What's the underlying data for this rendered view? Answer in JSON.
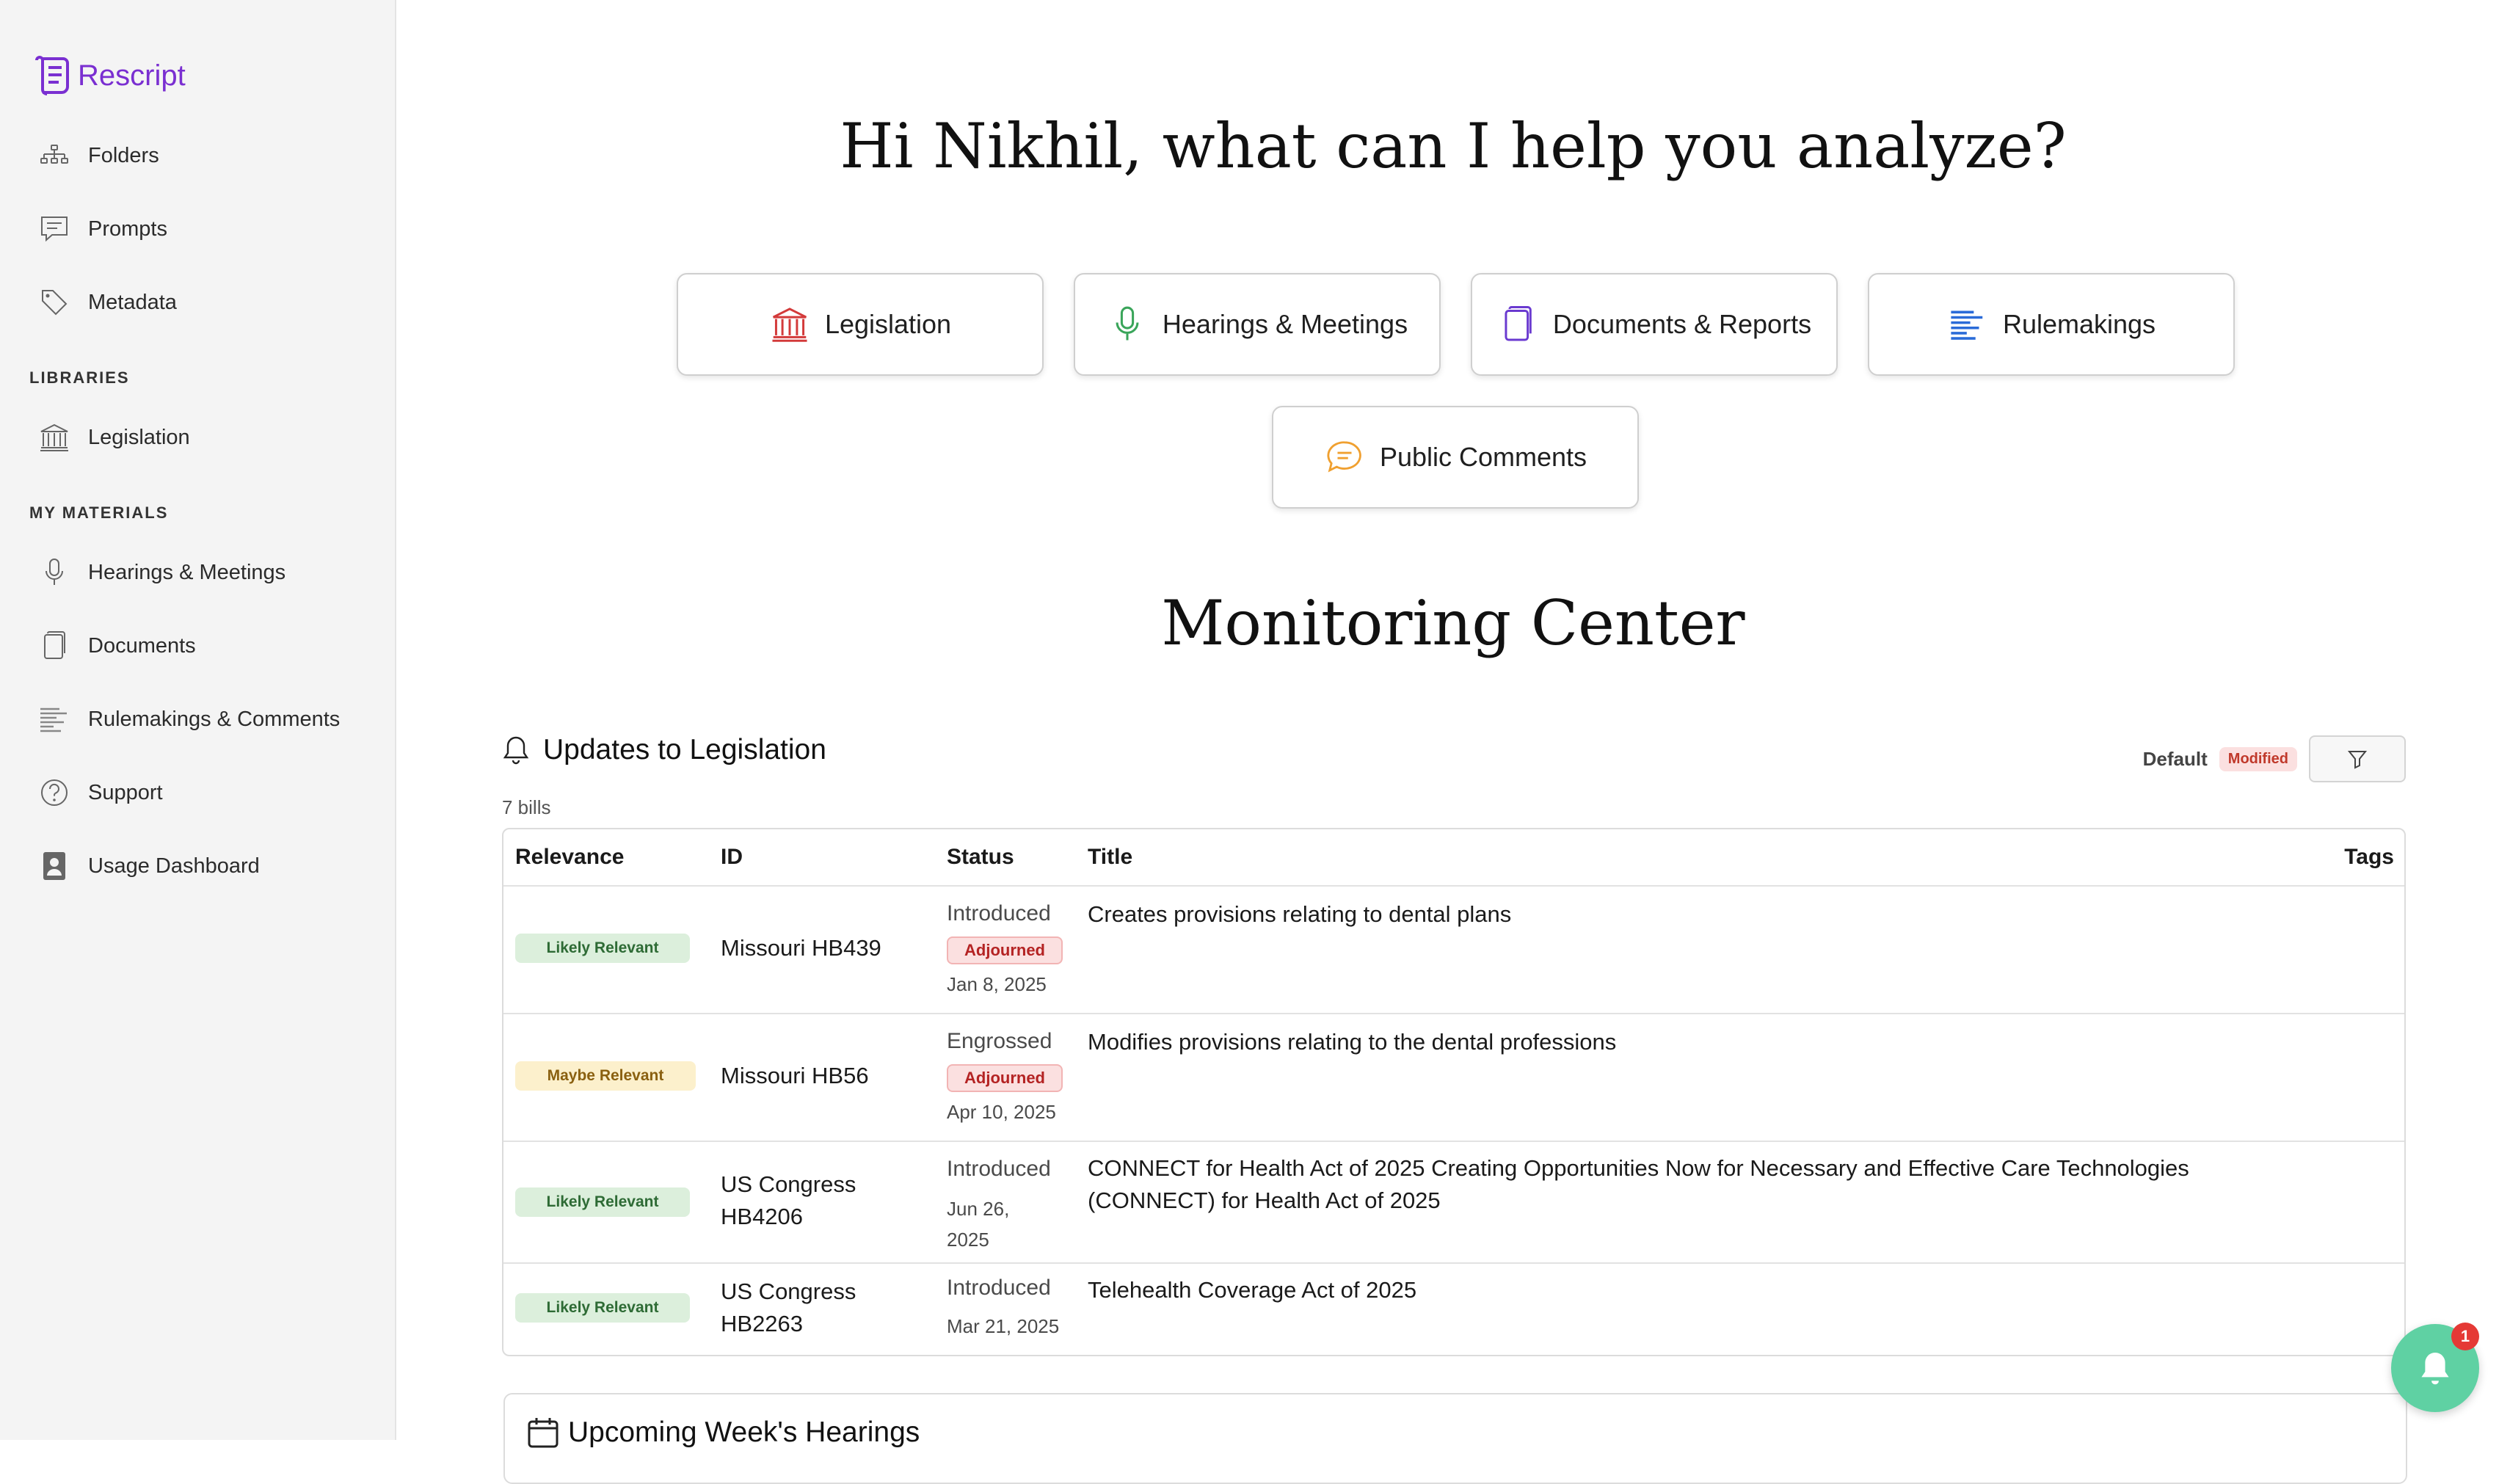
{
  "brand": {
    "name": "Rescript",
    "color": "#7a2fd1"
  },
  "sidebar": {
    "top_items": [
      {
        "label": "Folders",
        "icon": "folders-icon"
      },
      {
        "label": "Prompts",
        "icon": "chat-icon"
      },
      {
        "label": "Metadata",
        "icon": "tag-icon"
      }
    ],
    "libraries_label": "LIBRARIES",
    "libraries_items": [
      {
        "label": "Legislation",
        "icon": "capitol-icon"
      }
    ],
    "materials_label": "MY MATERIALS",
    "materials_items": [
      {
        "label": "Hearings & Meetings",
        "icon": "microphone-icon"
      },
      {
        "label": "Documents",
        "icon": "documents-icon"
      },
      {
        "label": "Rulemakings & Comments",
        "icon": "rulemaking-icon"
      },
      {
        "label": "Support",
        "icon": "help-icon"
      },
      {
        "label": "Usage Dashboard",
        "icon": "dashboard-icon"
      }
    ]
  },
  "greeting": "Hi Nikhil, what can I help you analyze?",
  "quick_actions": [
    {
      "label": "Legislation",
      "icon": "capitol-icon",
      "color": "#d33a3a"
    },
    {
      "label": "Hearings & Meetings",
      "icon": "microphone-icon",
      "color": "#3aa55a"
    },
    {
      "label": "Documents & Reports",
      "icon": "documents-icon",
      "color": "#6a3ad0"
    },
    {
      "label": "Rulemakings",
      "icon": "rulemaking-icon",
      "color": "#2a6bd8"
    },
    {
      "label": "Public Comments",
      "icon": "comment-icon",
      "color": "#f0a030"
    }
  ],
  "monitoring": {
    "title": "Monitoring Center",
    "updates_title": "Updates to Legislation",
    "bill_count": "7 bills",
    "filter_default": "Default",
    "filter_modified": "Modified",
    "columns": {
      "relevance": "Relevance",
      "id": "ID",
      "status": "Status",
      "title": "Title",
      "tags": "Tags"
    },
    "rows": [
      {
        "relevance": "Likely Relevant",
        "relevance_kind": "likely",
        "id": "Missouri HB439",
        "status": "Introduced",
        "status_badge": "Adjourned",
        "date": "Jan 8, 2025",
        "title": "Creates provisions relating to dental plans"
      },
      {
        "relevance": "Maybe Relevant",
        "relevance_kind": "maybe",
        "id": "Missouri HB56",
        "status": "Engrossed",
        "status_badge": "Adjourned",
        "date": "Apr 10, 2025",
        "title": "Modifies provisions relating to the dental professions"
      },
      {
        "relevance": "Likely Relevant",
        "relevance_kind": "likely",
        "id": "US Congress HB4206",
        "status": "Introduced",
        "status_badge": "",
        "date": "Jun 26, 2025",
        "title": "CONNECT for Health Act of 2025 Creating Opportunities Now for Necessary and Effective Care Technologies (CONNECT) for Health Act of 2025"
      },
      {
        "relevance": "Likely Relevant",
        "relevance_kind": "likely",
        "id": "US Congress HB2263",
        "status": "Introduced",
        "status_badge": "",
        "date": "Mar 21, 2025",
        "title": "Telehealth Coverage Act of 2025"
      }
    ],
    "hearings_title": "Upcoming Week's Hearings"
  },
  "notifications": {
    "count": "1",
    "color": "#5fd1a3"
  }
}
